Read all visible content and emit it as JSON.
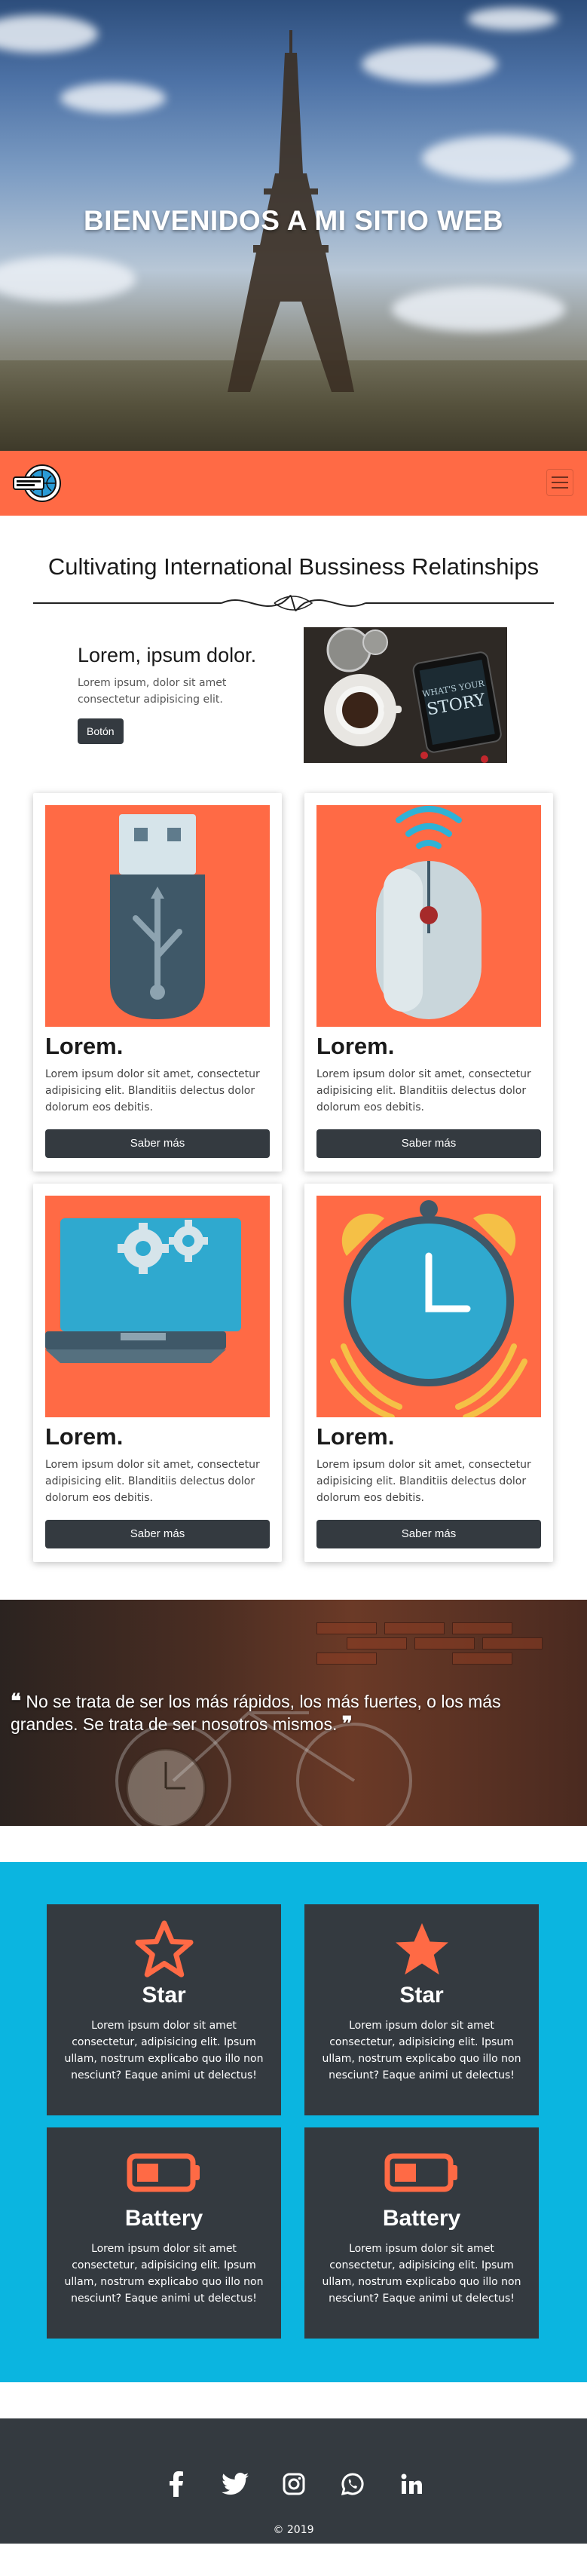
{
  "hero": {
    "title": "BIENVENIDOS A MI SITIO WEB"
  },
  "navbar": {
    "logo": "world-logo",
    "toggler": "menu-icon"
  },
  "intro": {
    "title": "Cultivating International Bussiness Relatinships"
  },
  "feature": {
    "heading": "Lorem, ipsum dolor.",
    "text": "Lorem ipsum, dolor sit amet consectetur adipisicing elit.",
    "button": "Botón",
    "image_text": "WHAT'S YOUR STORY"
  },
  "cards": [
    {
      "title": "Lorem.",
      "text": "Lorem ipsum dolor sit amet, consectetur adipisicing elit. Blanditiis delectus dolor dolorum eos debitis.",
      "button": "Saber más",
      "icon": "usb-drive-icon"
    },
    {
      "title": "Lorem.",
      "text": "Lorem ipsum dolor sit amet, consectetur adipisicing elit. Blanditiis delectus dolor dolorum eos debitis.",
      "button": "Saber más",
      "icon": "wireless-mouse-icon"
    },
    {
      "title": "Lorem.",
      "text": "Lorem ipsum dolor sit amet, consectetur adipisicing elit. Blanditiis delectus dolor dolorum eos debitis.",
      "button": "Saber más",
      "icon": "laptop-gears-icon"
    },
    {
      "title": "Lorem.",
      "text": "Lorem ipsum dolor sit amet, consectetur adipisicing elit. Blanditiis delectus dolor dolorum eos debitis.",
      "button": "Saber más",
      "icon": "alarm-clock-icon"
    }
  ],
  "quote": {
    "text": "No se trata de ser los más rápidos, los más fuertes, o los más grandes. Se trata de ser nosotros mismos."
  },
  "services": [
    {
      "title": "Star",
      "text": "Lorem ipsum dolor sit amet consectetur, adipisicing elit. Ipsum ullam, nostrum explicabo quo illo non nesciunt? Eaque animi ut delectus!",
      "icon": "star-icon"
    },
    {
      "title": "Star",
      "text": "Lorem ipsum dolor sit amet consectetur, adipisicing elit. Ipsum ullam, nostrum explicabo quo illo non nesciunt? Eaque animi ut delectus!",
      "icon": "star-icon"
    },
    {
      "title": "Battery",
      "text": "Lorem ipsum dolor sit amet consectetur, adipisicing elit. Ipsum ullam, nostrum explicabo quo illo non nesciunt? Eaque animi ut delectus!",
      "icon": "battery-icon"
    },
    {
      "title": "Battery",
      "text": "Lorem ipsum dolor sit amet consectetur, adipisicing elit. Ipsum ullam, nostrum explicabo quo illo non nesciunt? Eaque animi ut delectus!",
      "icon": "battery-icon"
    }
  ],
  "footer": {
    "social": [
      "facebook-icon",
      "twitter-icon",
      "instagram-icon",
      "whatsapp-icon",
      "linkedin-icon"
    ],
    "copyright": "© 2019"
  },
  "colors": {
    "accent": "#ff6a45",
    "dark": "#343a40",
    "services_bg": "#0bb5e0"
  }
}
